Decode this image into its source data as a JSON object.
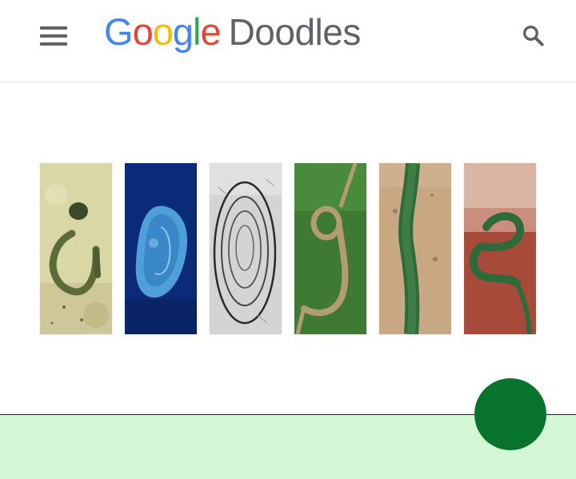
{
  "header": {
    "menu_icon": "hamburger-menu-icon",
    "brand_letters": [
      {
        "char": "G",
        "color": "#4285F4"
      },
      {
        "char": "o",
        "color": "#EA4335"
      },
      {
        "char": "o",
        "color": "#FBBC05"
      },
      {
        "char": "g",
        "color": "#4285F4"
      },
      {
        "char": "l",
        "color": "#34A853"
      },
      {
        "char": "e",
        "color": "#EA4335"
      }
    ],
    "brand_word": "Doodles",
    "brand_word_color": "#5f6368",
    "search_icon": "search-icon"
  },
  "doodle": {
    "tiles": [
      {
        "letter": "G",
        "terrain": "desert-lake"
      },
      {
        "letter": "o",
        "terrain": "ocean-island"
      },
      {
        "letter": "o",
        "terrain": "rock-rings"
      },
      {
        "letter": "g",
        "terrain": "forest-river"
      },
      {
        "letter": "l",
        "terrain": "green-valley"
      },
      {
        "letter": "e",
        "terrain": "red-plain"
      }
    ]
  },
  "footer": {
    "background": "#d4f7d6",
    "fab_color": "#07732b"
  }
}
